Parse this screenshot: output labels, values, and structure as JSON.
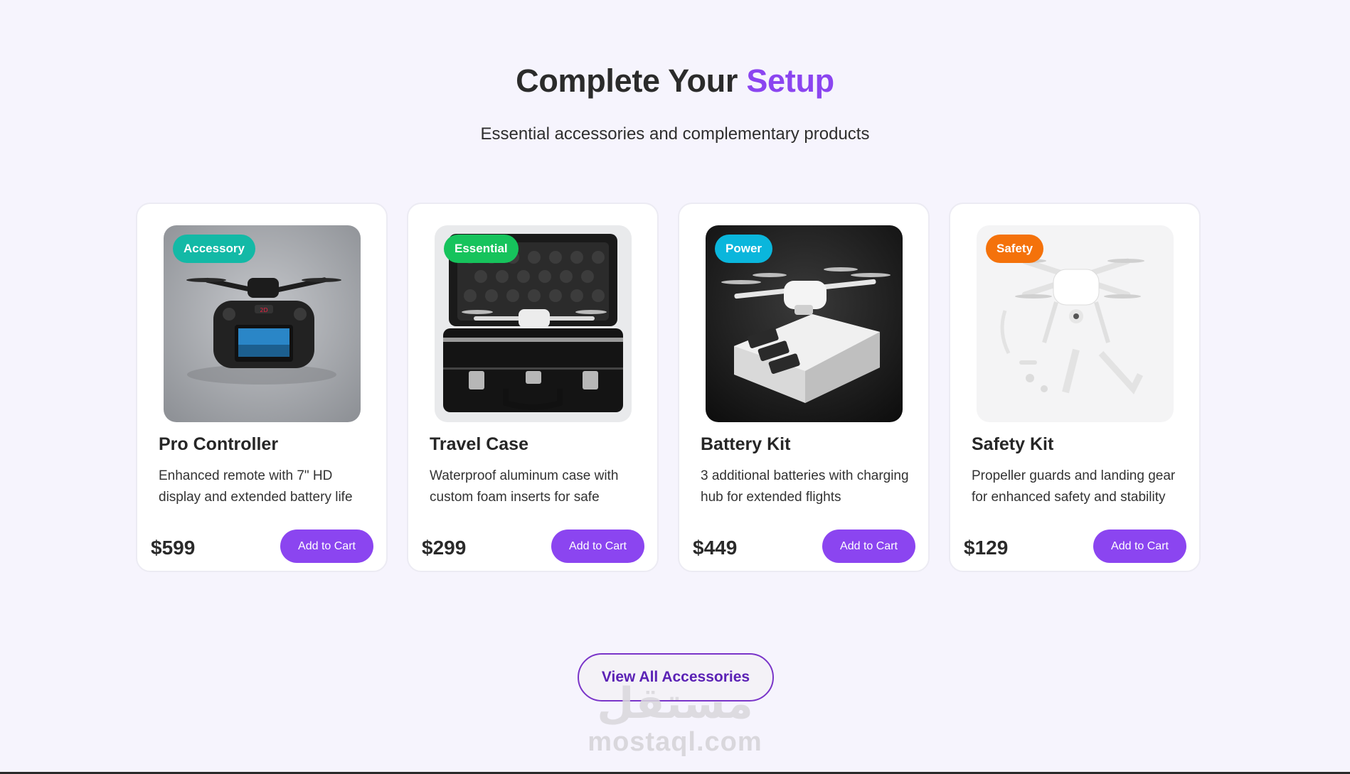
{
  "section": {
    "title_prefix": "Complete Your",
    "title_accent": "Setup",
    "subtitle": "Essential accessories and complementary products"
  },
  "products": [
    {
      "badge": "Accessory",
      "badge_color": "#13b9a6",
      "title": "Pro Controller",
      "description": "Enhanced remote with 7\" HD display and extended battery life",
      "price": "$599",
      "button": "Add to Cart",
      "image_icon": "controller-icon"
    },
    {
      "badge": "Essential",
      "badge_color": "#16c35c",
      "title": "Travel Case",
      "description": "Waterproof aluminum case with custom foam inserts for safe",
      "price": "$299",
      "button": "Add to Cart",
      "image_icon": "case-icon"
    },
    {
      "badge": "Power",
      "badge_color": "#0ab6dc",
      "title": "Battery Kit",
      "description": "3 additional batteries with charging hub for extended flights",
      "price": "$449",
      "button": "Add to Cart",
      "image_icon": "battery-icon"
    },
    {
      "badge": "Safety",
      "badge_color": "#f4720b",
      "title": "Safety Kit",
      "description": "Propeller guards and landing gear for enhanced safety and stability",
      "price": "$129",
      "button": "Add to Cart",
      "image_icon": "drone-icon"
    }
  ],
  "view_all": "View All Accessories",
  "watermark": {
    "arabic": "مستقل",
    "latin": "mostaql.com"
  },
  "colors": {
    "accent": "#8b45f0",
    "background": "#f6f4fd"
  }
}
